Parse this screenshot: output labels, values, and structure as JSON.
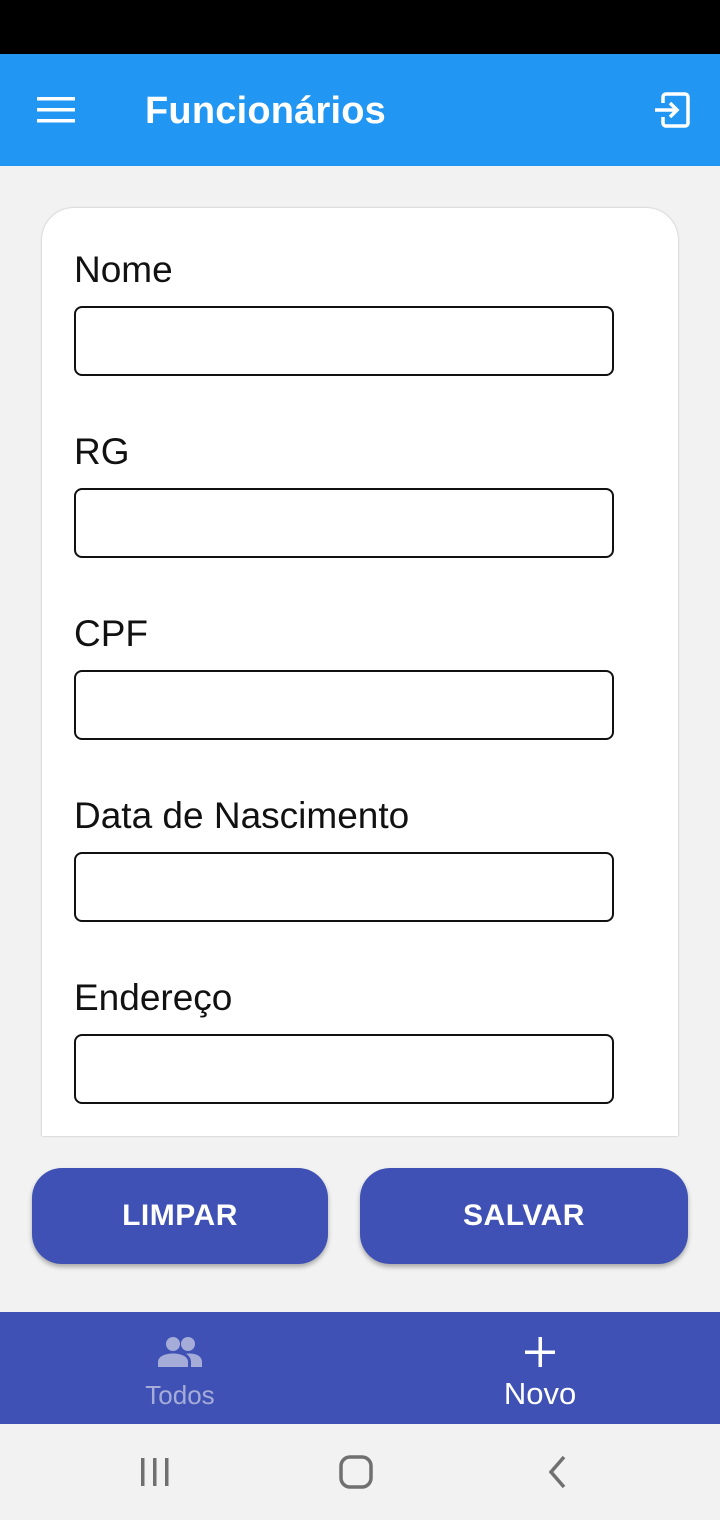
{
  "colors": {
    "app_bar": "#2196f3",
    "primary": "#3f51b5",
    "status_bar": "#000000",
    "background": "#f2f2f2"
  },
  "app_bar": {
    "title": "Funcionários",
    "menu_icon": "hamburger-menu-icon",
    "logout_icon": "logout-icon"
  },
  "form": {
    "fields": [
      {
        "label": "Nome",
        "value": ""
      },
      {
        "label": "RG",
        "value": ""
      },
      {
        "label": "CPF",
        "value": ""
      },
      {
        "label": "Data de Nascimento",
        "value": ""
      },
      {
        "label": "Endereço",
        "value": ""
      }
    ]
  },
  "actions": {
    "clear_label": "LIMPAR",
    "save_label": "SALVAR"
  },
  "bottom_nav": {
    "items": [
      {
        "label": "Todos",
        "icon": "people-icon",
        "active": false
      },
      {
        "label": "Novo",
        "icon": "plus-icon",
        "active": true
      }
    ]
  },
  "system_nav": {
    "recents_icon": "recents-icon",
    "home_icon": "home-icon",
    "back_icon": "back-icon"
  }
}
